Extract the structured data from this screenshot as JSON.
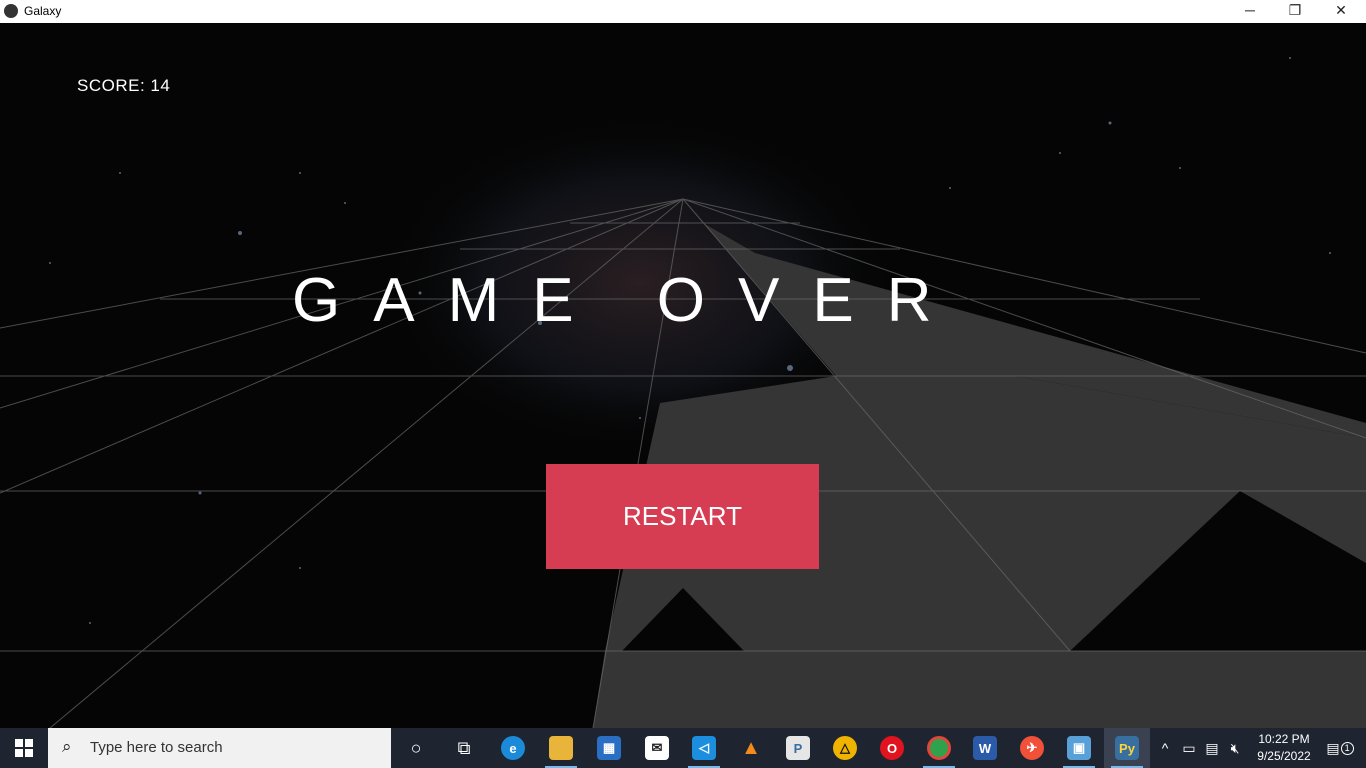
{
  "window": {
    "title": "Galaxy",
    "minimize_icon": "minimize-icon",
    "restore_icon": "restore-icon",
    "close_icon": "close-icon"
  },
  "game": {
    "score_label": "SCORE: 14",
    "title": "GAME OVER",
    "restart_label": "RESTART",
    "colors": {
      "button": "#d63c52",
      "tile": "#353535",
      "grid": "#6a6a6a",
      "background": "#050505"
    }
  },
  "taskbar": {
    "search_placeholder": "Type here to search",
    "apps": [
      "cortana",
      "task-view",
      "edge",
      "file-explorer",
      "microsoft-store",
      "mail",
      "vs-code",
      "vlc",
      "python-idle",
      "artix",
      "opera",
      "chrome",
      "word",
      "swift",
      "control-panel",
      "python"
    ],
    "clock": {
      "time": "10:22 PM",
      "date": "9/25/2022"
    },
    "notification_count": "1"
  }
}
